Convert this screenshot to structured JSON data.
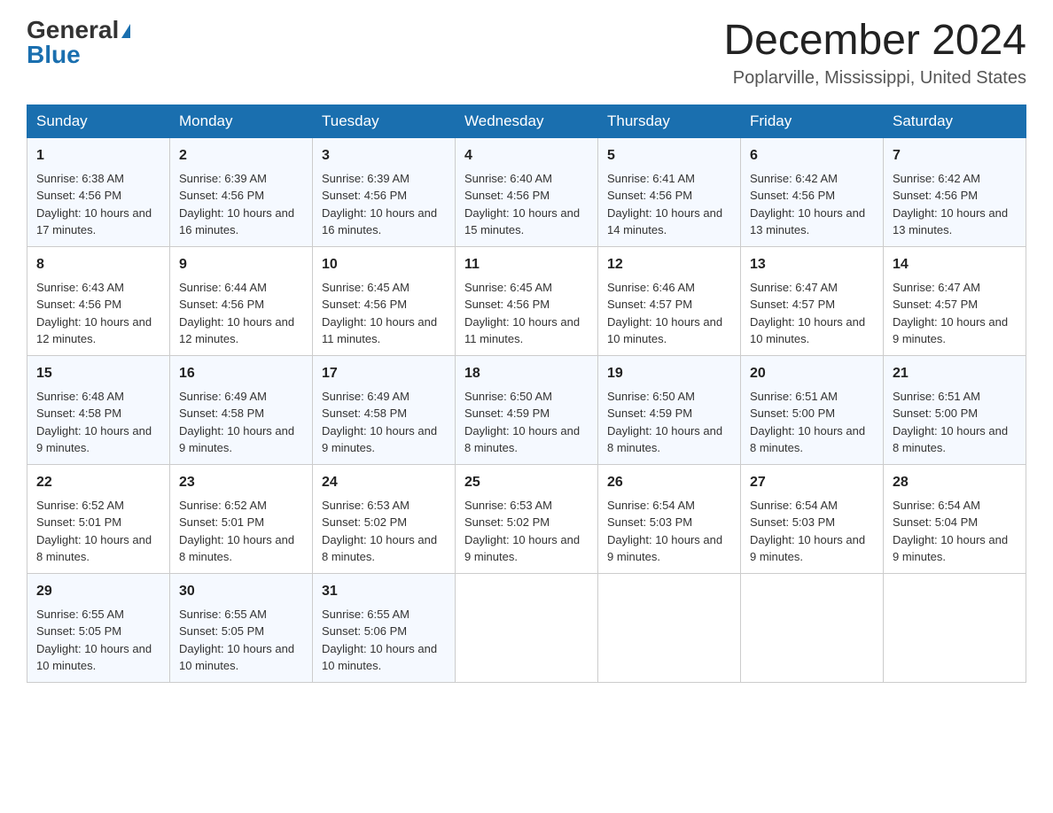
{
  "header": {
    "logo_general": "General",
    "logo_blue": "Blue",
    "month_title": "December 2024",
    "location": "Poplarville, Mississippi, United States"
  },
  "days_of_week": [
    "Sunday",
    "Monday",
    "Tuesday",
    "Wednesday",
    "Thursday",
    "Friday",
    "Saturday"
  ],
  "weeks": [
    [
      {
        "day": "1",
        "sunrise": "6:38 AM",
        "sunset": "4:56 PM",
        "daylight": "10 hours and 17 minutes."
      },
      {
        "day": "2",
        "sunrise": "6:39 AM",
        "sunset": "4:56 PM",
        "daylight": "10 hours and 16 minutes."
      },
      {
        "day": "3",
        "sunrise": "6:39 AM",
        "sunset": "4:56 PM",
        "daylight": "10 hours and 16 minutes."
      },
      {
        "day": "4",
        "sunrise": "6:40 AM",
        "sunset": "4:56 PM",
        "daylight": "10 hours and 15 minutes."
      },
      {
        "day": "5",
        "sunrise": "6:41 AM",
        "sunset": "4:56 PM",
        "daylight": "10 hours and 14 minutes."
      },
      {
        "day": "6",
        "sunrise": "6:42 AM",
        "sunset": "4:56 PM",
        "daylight": "10 hours and 13 minutes."
      },
      {
        "day": "7",
        "sunrise": "6:42 AM",
        "sunset": "4:56 PM",
        "daylight": "10 hours and 13 minutes."
      }
    ],
    [
      {
        "day": "8",
        "sunrise": "6:43 AM",
        "sunset": "4:56 PM",
        "daylight": "10 hours and 12 minutes."
      },
      {
        "day": "9",
        "sunrise": "6:44 AM",
        "sunset": "4:56 PM",
        "daylight": "10 hours and 12 minutes."
      },
      {
        "day": "10",
        "sunrise": "6:45 AM",
        "sunset": "4:56 PM",
        "daylight": "10 hours and 11 minutes."
      },
      {
        "day": "11",
        "sunrise": "6:45 AM",
        "sunset": "4:56 PM",
        "daylight": "10 hours and 11 minutes."
      },
      {
        "day": "12",
        "sunrise": "6:46 AM",
        "sunset": "4:57 PM",
        "daylight": "10 hours and 10 minutes."
      },
      {
        "day": "13",
        "sunrise": "6:47 AM",
        "sunset": "4:57 PM",
        "daylight": "10 hours and 10 minutes."
      },
      {
        "day": "14",
        "sunrise": "6:47 AM",
        "sunset": "4:57 PM",
        "daylight": "10 hours and 9 minutes."
      }
    ],
    [
      {
        "day": "15",
        "sunrise": "6:48 AM",
        "sunset": "4:58 PM",
        "daylight": "10 hours and 9 minutes."
      },
      {
        "day": "16",
        "sunrise": "6:49 AM",
        "sunset": "4:58 PM",
        "daylight": "10 hours and 9 minutes."
      },
      {
        "day": "17",
        "sunrise": "6:49 AM",
        "sunset": "4:58 PM",
        "daylight": "10 hours and 9 minutes."
      },
      {
        "day": "18",
        "sunrise": "6:50 AM",
        "sunset": "4:59 PM",
        "daylight": "10 hours and 8 minutes."
      },
      {
        "day": "19",
        "sunrise": "6:50 AM",
        "sunset": "4:59 PM",
        "daylight": "10 hours and 8 minutes."
      },
      {
        "day": "20",
        "sunrise": "6:51 AM",
        "sunset": "5:00 PM",
        "daylight": "10 hours and 8 minutes."
      },
      {
        "day": "21",
        "sunrise": "6:51 AM",
        "sunset": "5:00 PM",
        "daylight": "10 hours and 8 minutes."
      }
    ],
    [
      {
        "day": "22",
        "sunrise": "6:52 AM",
        "sunset": "5:01 PM",
        "daylight": "10 hours and 8 minutes."
      },
      {
        "day": "23",
        "sunrise": "6:52 AM",
        "sunset": "5:01 PM",
        "daylight": "10 hours and 8 minutes."
      },
      {
        "day": "24",
        "sunrise": "6:53 AM",
        "sunset": "5:02 PM",
        "daylight": "10 hours and 8 minutes."
      },
      {
        "day": "25",
        "sunrise": "6:53 AM",
        "sunset": "5:02 PM",
        "daylight": "10 hours and 9 minutes."
      },
      {
        "day": "26",
        "sunrise": "6:54 AM",
        "sunset": "5:03 PM",
        "daylight": "10 hours and 9 minutes."
      },
      {
        "day": "27",
        "sunrise": "6:54 AM",
        "sunset": "5:03 PM",
        "daylight": "10 hours and 9 minutes."
      },
      {
        "day": "28",
        "sunrise": "6:54 AM",
        "sunset": "5:04 PM",
        "daylight": "10 hours and 9 minutes."
      }
    ],
    [
      {
        "day": "29",
        "sunrise": "6:55 AM",
        "sunset": "5:05 PM",
        "daylight": "10 hours and 10 minutes."
      },
      {
        "day": "30",
        "sunrise": "6:55 AM",
        "sunset": "5:05 PM",
        "daylight": "10 hours and 10 minutes."
      },
      {
        "day": "31",
        "sunrise": "6:55 AM",
        "sunset": "5:06 PM",
        "daylight": "10 hours and 10 minutes."
      },
      null,
      null,
      null,
      null
    ]
  ],
  "labels": {
    "sunrise": "Sunrise:",
    "sunset": "Sunset:",
    "daylight": "Daylight:"
  }
}
